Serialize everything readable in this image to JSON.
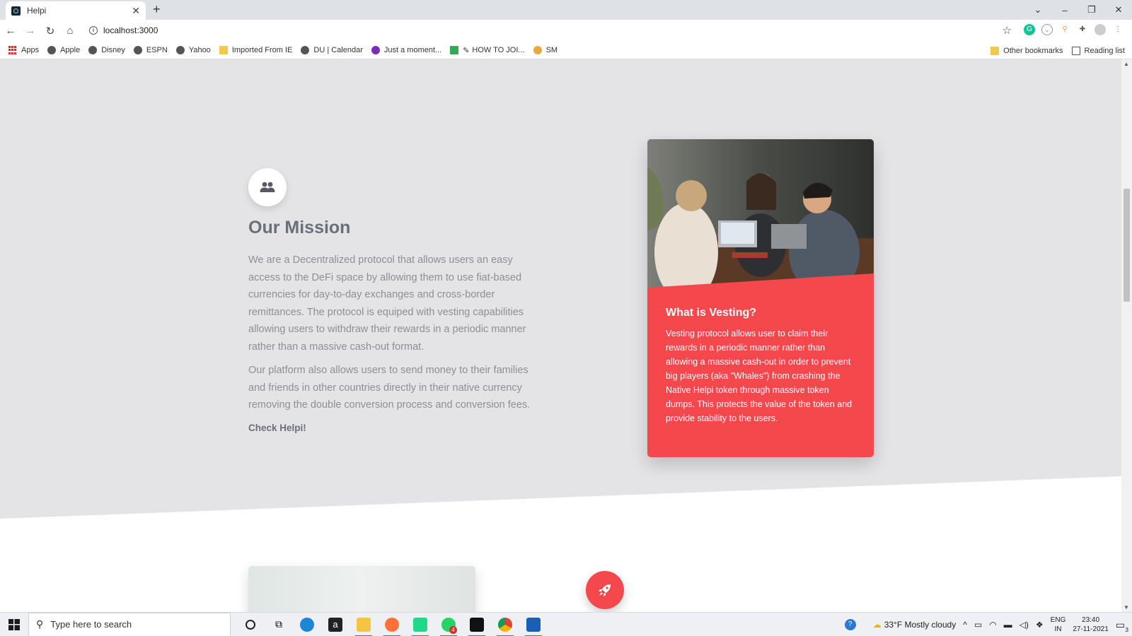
{
  "browser": {
    "tab_title": "Helpi",
    "url": "localhost:3000",
    "bookmarks": [
      "Apps",
      "Apple",
      "Disney",
      "ESPN",
      "Yahoo",
      "Imported From IE",
      "DU | Calendar",
      "Just a moment...",
      "HOW TO JOI...",
      "SM"
    ],
    "other_bookmarks": "Other bookmarks",
    "reading_list": "Reading list"
  },
  "mission": {
    "title": "Our Mission",
    "paragraph1": "We are a Decentralized protocol that allows users an easy access to the DeFi space by allowing them to use fiat-based currencies for day-to-day exchanges and cross-border remittances. The protocol is equiped with vesting capabilities allowing users to withdraw their rewards in a periodic manner rather than a massive cash-out format.",
    "paragraph2": "Our platform also allows users to send money to their families and friends in other countries directly in their native currency removing the double conversion process and conversion fees.",
    "link": "Check Helpi!"
  },
  "vesting_card": {
    "title": "What is Vesting?",
    "text": "Vesting protocol allows user to claim their rewards in a periodic manner rather than allowing a massive cash-out in order to prevent big players (aka \"Whales\") from crashing the Native Helpi token through massive token dumps. This protects the value of the token and provide stability to the users."
  },
  "taskbar": {
    "search_placeholder": "Type here to search",
    "weather": "33°F  Mostly cloudy",
    "lang1": "ENG",
    "lang2": "IN",
    "time": "23:40",
    "date": "27-11-2021",
    "notification_count": "3",
    "whatsapp_badge": "4"
  },
  "colors": {
    "accent": "#f5484d",
    "page_bg": "#e4e4e7",
    "heading": "#6b6f7a"
  }
}
